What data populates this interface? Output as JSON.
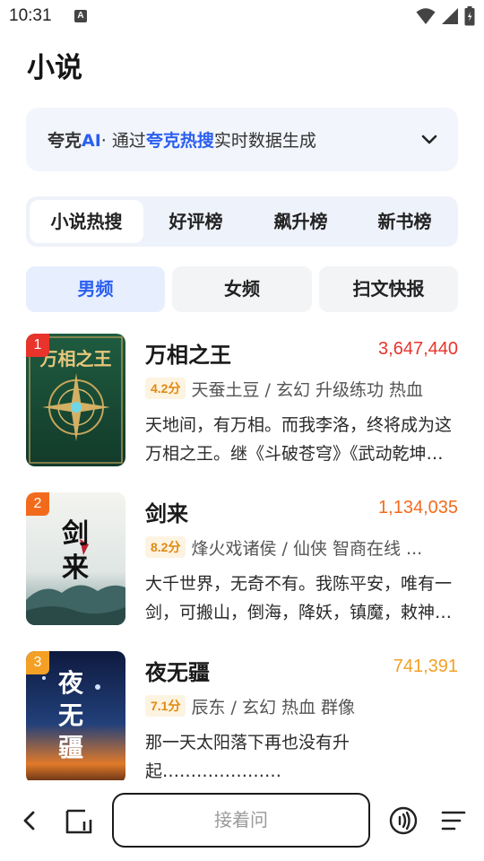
{
  "status": {
    "time": "10:31",
    "notification_badge": "A",
    "icons": [
      "wifi-icon",
      "signal-icon",
      "battery-icon"
    ]
  },
  "page": {
    "title": "小说"
  },
  "ai_banner": {
    "brand": "夸克",
    "brand_ai": "AI",
    "prefix": "· 通过",
    "link": "夸克热搜",
    "suffix": "实时数据生成"
  },
  "main_tabs": [
    {
      "label": "小说热搜",
      "active": true
    },
    {
      "label": "好评榜",
      "active": false
    },
    {
      "label": "飙升榜",
      "active": false
    },
    {
      "label": "新书榜",
      "active": false
    }
  ],
  "sub_tabs": [
    {
      "label": "男频",
      "active": true
    },
    {
      "label": "女频",
      "active": false
    },
    {
      "label": "扫文快报",
      "active": false
    }
  ],
  "books": [
    {
      "rank": "1",
      "rank_color": "#e8342b",
      "title": "万相之王",
      "hot": "3,647,440",
      "hot_color": "#e8342b",
      "score": "4.2分",
      "meta": "天蚕土豆 / 玄幻 升级练功 热血",
      "desc": "天地间，有万相。而我李洛，终将成为这万相之王。继《斗破苍穹》《武动乾坤》《大主宰》《元尊》之后，天蚕土豆又一部力作。",
      "cover_title": "万相之王"
    },
    {
      "rank": "2",
      "rank_color": "#f26b1d",
      "title": "剑来",
      "hot": "1,134,035",
      "hot_color": "#f26b1d",
      "score": "8.2分",
      "meta": "烽火戏诸侯 / 仙侠 智商在线 ...",
      "desc": "大千世界，无奇不有。我陈平安，唯有一剑，可搬山，倒海，降妖，镇魔，敕神，摘星，断江，摧城，开天！",
      "cover_title": "剑来"
    },
    {
      "rank": "3",
      "rank_color": "#f3a024",
      "title": "夜无疆",
      "hot": "741,391",
      "hot_color": "#f3a024",
      "score": "7.1分",
      "meta": "辰东 / 玄幻 热血 群像",
      "desc": "那一天太阳落下再也没有升起…………………",
      "cover_title": "夜无疆"
    }
  ],
  "bottom_bar": {
    "ask_placeholder": "接着问"
  }
}
